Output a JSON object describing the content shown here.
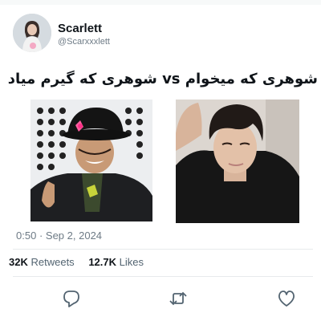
{
  "author": {
    "name": "Scarlett",
    "handle": "@Scarxxxlett"
  },
  "tweet": {
    "text": "شوهری که میخوام vs شوهری که گیرم میاد",
    "time": "0:50",
    "separator": "·",
    "date": "Sep 2, 2024"
  },
  "stats": {
    "retweets_count": "32K",
    "retweets_label": "Retweets",
    "likes_count": "12.7K",
    "likes_label": "Likes"
  },
  "icons": {
    "reply": "reply-icon",
    "retweet": "retweet-icon",
    "like": "like-icon"
  },
  "colors": {
    "text": "#0f1419",
    "secondary": "#6e7b86",
    "icon": "#536471",
    "divider": "#e7eaec"
  }
}
